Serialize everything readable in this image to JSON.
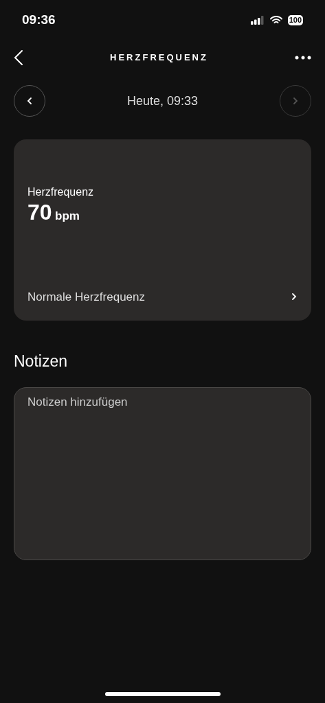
{
  "status_bar": {
    "time": "09:36",
    "battery": "100"
  },
  "header": {
    "title": "HERZFREQUENZ"
  },
  "date_nav": {
    "label": "Heute, 09:33",
    "prev": {
      "disabled": false
    },
    "next": {
      "disabled": true
    }
  },
  "reading_card": {
    "title": "Herzfrequenz",
    "value": "70",
    "unit": "bpm",
    "link": "Normale Herzfrequenz"
  },
  "notes": {
    "heading": "Notizen",
    "placeholder": "Notizen hinzufügen"
  }
}
